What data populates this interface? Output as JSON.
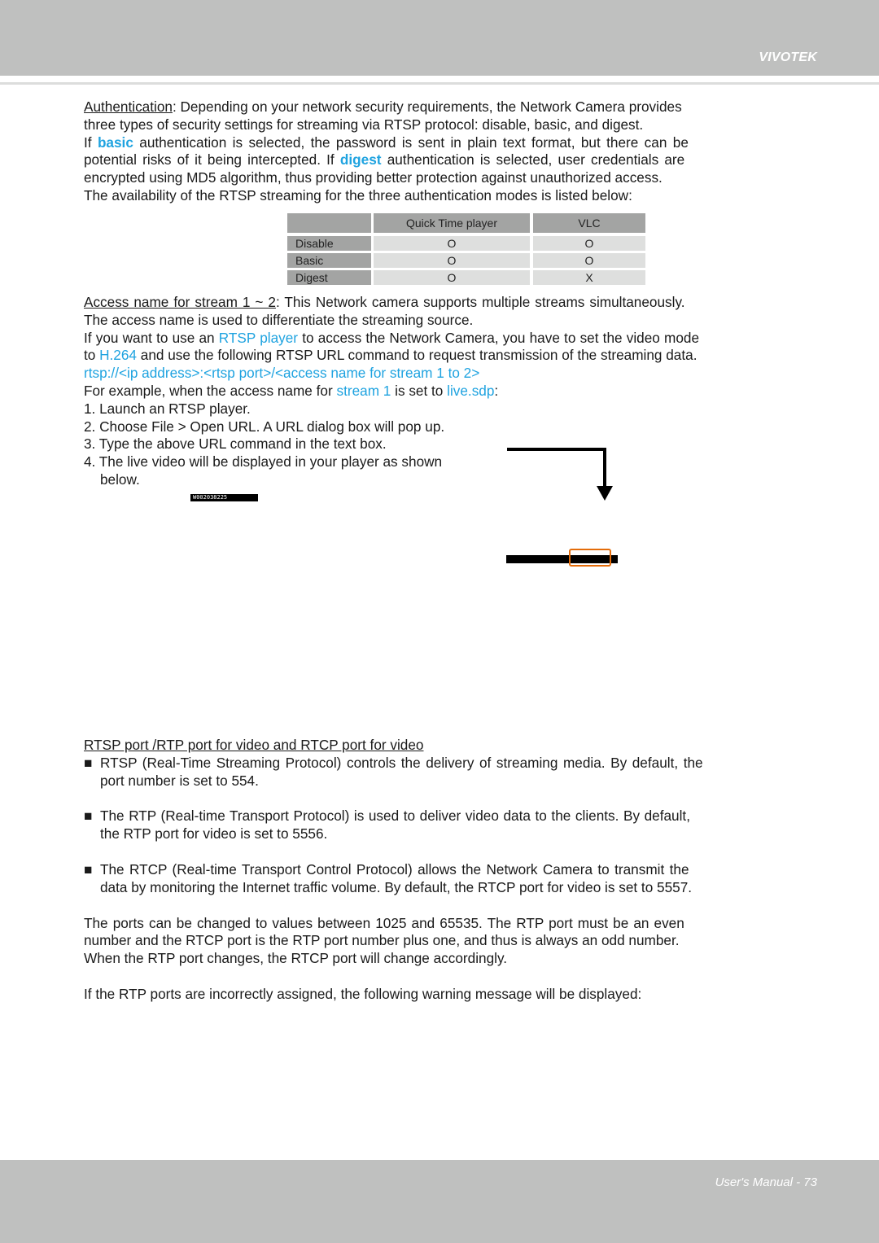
{
  "header": {
    "brand": "VIVOTEK"
  },
  "footer": {
    "page_label": "User's Manual - 73"
  },
  "authentication": {
    "term": "Authentication",
    "line1_rest": ": Depending on your network security requirements, the Network Camera provides",
    "line2": "three types of security settings for streaming via RTSP protocol: disable, basic, and digest.",
    "line3_pre": "If ",
    "basic": "basic",
    "line3_post": " authentication is selected, the password is sent in plain text format, but there can be",
    "line4_pre": "potential risks of it being intercepted. If ",
    "digest": "digest",
    "line4_post": " authentication is selected, user credentials are",
    "line5": "encrypted using MD5 algorithm, thus providing better protection against unauthorized access.",
    "line6": "The availability of the RTSP streaming for the three authentication modes is listed below:"
  },
  "auth_table": {
    "columns": [
      "",
      "Quick Time player",
      "VLC"
    ],
    "rows": [
      {
        "mode": "Disable",
        "quicktime": "O",
        "vlc": "O"
      },
      {
        "mode": "Basic",
        "quicktime": "O",
        "vlc": "O"
      },
      {
        "mode": "Digest",
        "quicktime": "O",
        "vlc": "X"
      }
    ]
  },
  "access_name": {
    "term": "Access name for stream 1 ~ 2",
    "line1_rest": ": This Network camera supports multiple streams simultaneously.",
    "line2": "The access name is used to differentiate the streaming source.",
    "line3_pre": "If you want to use an ",
    "rtsp_player": "RTSP player",
    "line3_post": " to access the Network Camera, you have to set the video mode",
    "line4_pre": "to ",
    "h264": "H.264",
    "line4_post": " and use the following RTSP URL command to request transmission of the streaming data.",
    "url": "rtsp://<ip address>:<rtsp port>/<access name for stream 1 to 2>",
    "example_pre": "For example, when the access name for ",
    "example_stream": "stream 1",
    "example_mid": " is set to ",
    "example_value": "live.sdp",
    "example_post": ":",
    "steps": [
      "1. Launch an RTSP player.",
      "2. Choose File > Open URL. A URL dialog box will pop up.",
      "3. Type the above URL command in the text box.",
      "4. The live video will be displayed in your player as shown"
    ],
    "step4_cont": "below.",
    "video_timestamp": "W002038225"
  },
  "ports": {
    "heading": "RTSP port /RTP port for video and RTCP port for video",
    "bullet_glyph": "■",
    "bullets": [
      {
        "line1": "RTSP (Real-Time Streaming Protocol) controls the delivery of streaming media. By default, the",
        "line2": "port number is set to 554."
      },
      {
        "line1": "The RTP (Real-time Transport Protocol) is used to deliver video data to the clients. By default,",
        "line2": "the RTP port for video is set to 5556."
      },
      {
        "line1": "The RTCP (Real-time Transport Control Protocol) allows the Network Camera to transmit the",
        "line2": "data by monitoring the Internet traffic volume. By default, the RTCP port for video is set to 5557."
      }
    ],
    "para1": [
      "The ports can be changed to values between 1025 and 65535. The RTP port must be an even",
      "number and the RTCP port is the RTP port number plus one, and thus is always an odd number.",
      "When the RTP port changes, the RTCP port will change accordingly."
    ],
    "para2": "If the RTP ports are incorrectly assigned, the following warning message will be displayed:"
  },
  "colors": {
    "highlight": "#1fa3e0",
    "header_bg": "#bfc0bf",
    "annotation_box": "#e46c0a"
  }
}
